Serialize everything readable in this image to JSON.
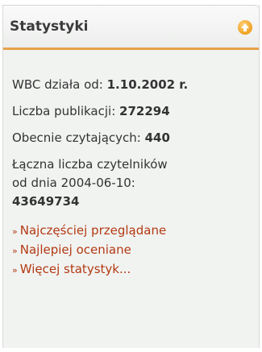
{
  "panel": {
    "title": "Statystyki",
    "collapse_icon": "arrow-up-icon",
    "accent_color": "#e8a04a",
    "link_color": "#b33a12"
  },
  "stats": {
    "since_label": "WBC działa od:",
    "since_value": "1.10.2002 r.",
    "publications_label": "Liczba publikacji:",
    "publications_value": "272294",
    "readers_now_label": "Obecnie czytających:",
    "readers_now_value": "440",
    "total_readers_line1": "Łączna liczba czytelników",
    "total_readers_line2": "od dnia 2004-06-10:",
    "total_readers_value": "43649734"
  },
  "links": [
    {
      "label": "Najczęściej przeglądane"
    },
    {
      "label": "Najlepiej oceniane"
    },
    {
      "label": "Więcej statystyk..."
    }
  ],
  "link_prefix": "»"
}
